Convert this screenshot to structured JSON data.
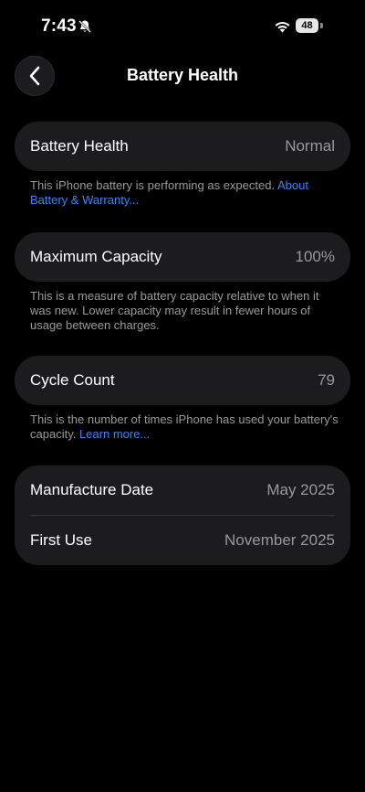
{
  "status_bar": {
    "time": "7:43",
    "battery_level": "48"
  },
  "nav": {
    "title": "Battery Health"
  },
  "health": {
    "label": "Battery Health",
    "value": "Normal",
    "note": "This iPhone battery is performing as expected. ",
    "link": "About Battery & Warranty..."
  },
  "capacity": {
    "label": "Maximum Capacity",
    "value": "100%",
    "note": "This is a measure of battery capacity relative to when it was new. Lower capacity may result in fewer hours of usage between charges."
  },
  "cycles": {
    "label": "Cycle Count",
    "value": "79",
    "note": "This is the number of times iPhone has used your battery's capacity. ",
    "link": "Learn more..."
  },
  "dates": {
    "manufacture_label": "Manufacture Date",
    "manufacture_value": "May 2025",
    "first_use_label": "First Use",
    "first_use_value": "November 2025"
  },
  "colors": {
    "background": "#000000",
    "card": "#1c1c1e",
    "secondary_text": "#98989f",
    "link": "#3a82f7"
  }
}
